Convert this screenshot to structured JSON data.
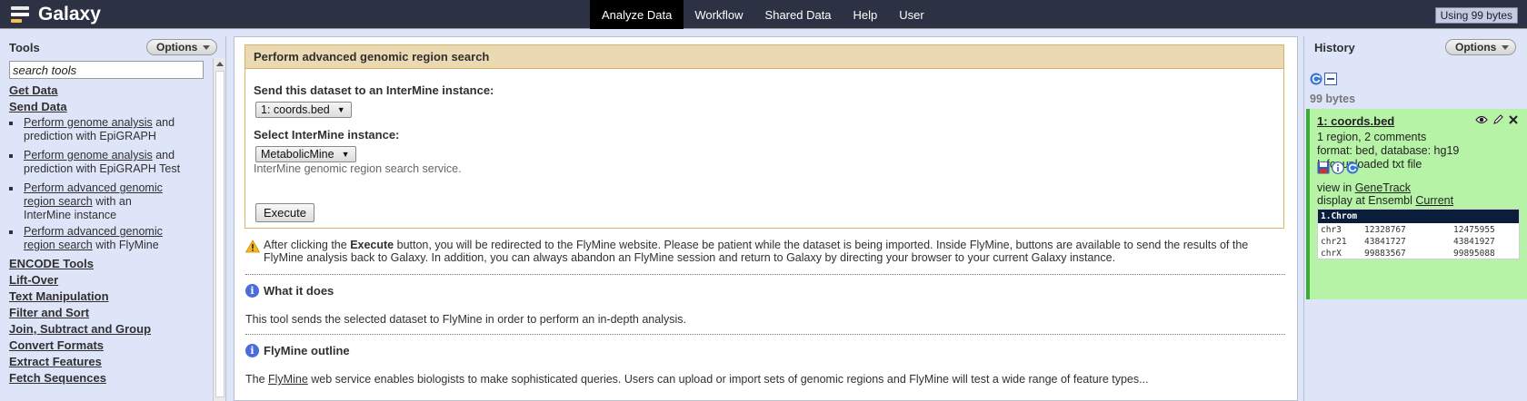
{
  "app": {
    "name": "Galaxy",
    "quota": "Using 99 bytes"
  },
  "nav": {
    "tabs": [
      {
        "label": "Analyze Data",
        "active": true
      },
      {
        "label": "Workflow",
        "active": false
      },
      {
        "label": "Shared Data",
        "active": false
      },
      {
        "label": "Help",
        "active": false
      },
      {
        "label": "User",
        "active": false
      }
    ]
  },
  "tools": {
    "title": "Tools",
    "options_label": "Options",
    "search_placeholder": "search tools",
    "sections_top": [
      "Get Data",
      "Send Data"
    ],
    "items": [
      {
        "link": "Perform genome analysis",
        "rest1": " and",
        "rest2": "prediction with EpiGRAPH"
      },
      {
        "link": "Perform genome analysis",
        "rest1": " and",
        "rest2": "prediction with EpiGRAPH Test"
      },
      {
        "link1": "Perform advanced genomic",
        "link2": "region search",
        "rest2": " with an",
        "rest3": "InterMine instance"
      },
      {
        "link1": "Perform advanced genomic",
        "link2": "region search",
        "rest2": " with FlyMine"
      }
    ],
    "sections_bottom": [
      "ENCODE Tools",
      "Lift-Over",
      "Text Manipulation",
      "Filter and Sort",
      "Join, Subtract and Group",
      "Convert Formats",
      "Extract Features",
      "Fetch Sequences"
    ]
  },
  "form": {
    "title": "Perform advanced genomic region search",
    "dataset_label": "Send this dataset to an InterMine instance:",
    "dataset_value": "1: coords.bed",
    "instance_label": "Select InterMine instance:",
    "instance_value": "MetabolicMine",
    "instance_help": "InterMine genomic region search service.",
    "execute_label": "Execute"
  },
  "warning": {
    "pre": "After clicking the ",
    "bold": "Execute",
    "post": " button, you will be redirected to the FlyMine website. Please be patient while the dataset is being imported. Inside FlyMine, buttons are available to send the results of the FlyMine analysis back to Galaxy. In addition, you can always abandon an FlyMine session and return to Galaxy by directing your browser to your current Galaxy instance."
  },
  "what_it_does": {
    "title": "What it does",
    "text": "This tool sends the selected dataset to FlyMine in order to perform an in-depth analysis."
  },
  "outline": {
    "title": "FlyMine outline",
    "pre": "The ",
    "link": "FlyMine",
    "post": " web service enables biologists to make sophisticated queries. Users can upload or import sets of genomic regions and FlyMine will test a wide range of feature types..."
  },
  "history": {
    "title": "History",
    "options_label": "Options",
    "size": "99 bytes",
    "dataset": {
      "name": "1: coords.bed",
      "summary": "1 region, 2 comments",
      "format": "format: bed, database: hg19",
      "info": "Info: uploaded txt file",
      "view_pre": "view in ",
      "view_link": "GeneTrack",
      "display_pre": "display at Ensembl ",
      "display_link": "Current",
      "peek_header": "1.Chrom",
      "peek_rows": [
        [
          "chr3",
          "12328767",
          "12475955"
        ],
        [
          "chr21",
          "43841727",
          "43841927"
        ],
        [
          "chrX",
          "99883567",
          "99895088"
        ]
      ]
    }
  }
}
